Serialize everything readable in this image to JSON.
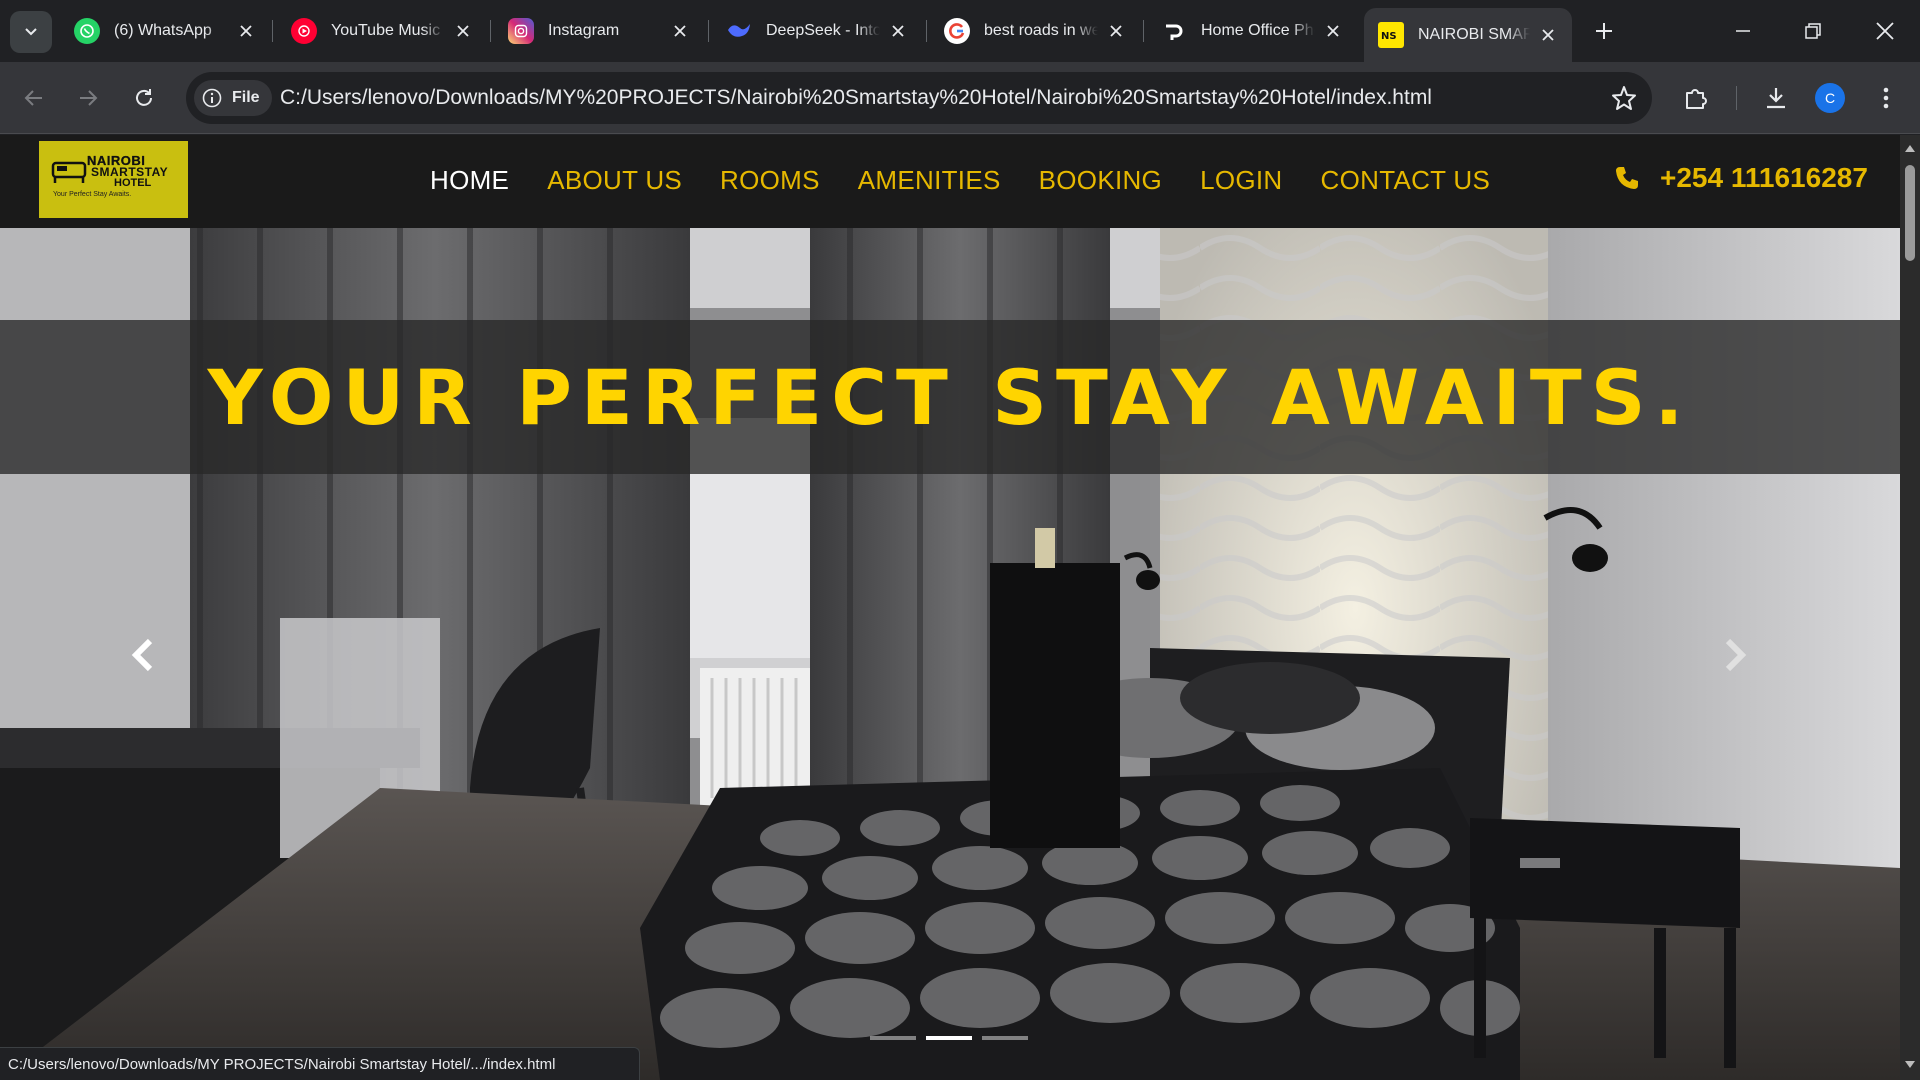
{
  "browser": {
    "tabs": [
      {
        "title": "(6) WhatsApp",
        "icon": "whatsapp-icon"
      },
      {
        "title": "YouTube Music",
        "icon": "youtube-music-icon"
      },
      {
        "title": "Instagram",
        "icon": "instagram-icon"
      },
      {
        "title": "DeepSeek - Into the Unknown",
        "icon": "deepseek-icon"
      },
      {
        "title": "best roads in western kenya",
        "icon": "google-icon"
      },
      {
        "title": "Home Office Photos",
        "icon": "pexels-icon"
      },
      {
        "title": "NAIROBI SMARTSTAY HOTEL",
        "icon": "ns-favicon-icon"
      }
    ],
    "active_tab_index": 6,
    "address_chip": "File",
    "url": "C:/Users/lenovo/Downloads/MY%20PROJECTS/Nairobi%20Smartstay%20Hotel/Nairobi%20Smartstay%20Hotel/index.html",
    "profile_initial": "C",
    "status_url": "C:/Users/lenovo/Downloads/MY PROJECTS/Nairobi Smartstay Hotel/.../index.html"
  },
  "site": {
    "logo": {
      "line1": "NAIROBI",
      "line2": "SMARTSTAY",
      "line3": "HOTEL",
      "tagline": "Your Perfect Stay Awaits."
    },
    "nav": [
      "HOME",
      "ABOUT US",
      "ROOMS",
      "AMENITIES",
      "BOOKING",
      "LOGIN",
      "CONTACT US"
    ],
    "active_nav": "HOME",
    "phone": "+254 111616287",
    "hero": {
      "headline": "YOUR PERFECT STAY AWAITS.",
      "slide_count": 3,
      "active_slide": 2
    }
  },
  "colors": {
    "brand_yellow": "#ffd400",
    "nav_gold": "#e6b800",
    "logo_bg": "#c9bf10",
    "header_bg": "#1a1a1a"
  }
}
